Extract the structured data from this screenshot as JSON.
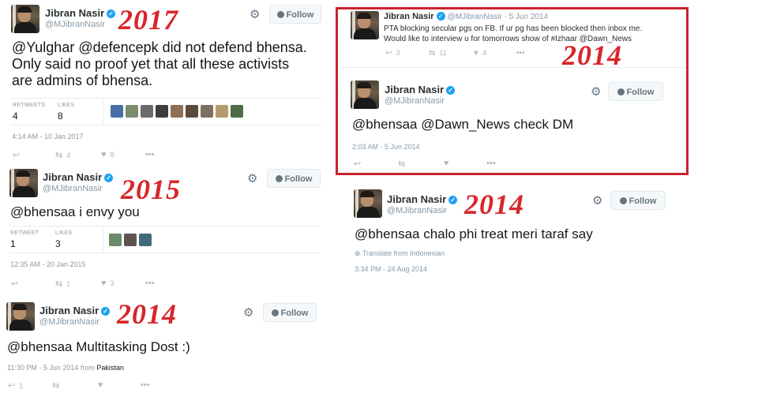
{
  "account": {
    "name": "Jibran Nasir",
    "handle": "@MJibranNasir",
    "follow_label": "Follow"
  },
  "colors": {
    "year_label": "#d8262b",
    "frame": "#c9232b",
    "verified": "#1da1f2"
  },
  "tweet_2017": {
    "year": "2017",
    "lines": [
      "@Yulghar @defencepk did not defend bhensa.",
      "Only said no proof yet that all these activists",
      "are admins of bhensa."
    ],
    "retweets_label": "RETWEETS",
    "retweets": "4",
    "likes_label": "LIKES",
    "likes": "8",
    "time": "4:14 AM - 10 Jan 2017",
    "action_retweets": "4",
    "action_likes": "8",
    "liker_avatar_count": 9
  },
  "tweet_2015": {
    "year": "2015",
    "text": "@bhensaa i envy you",
    "retweets_label": "RETWEET",
    "retweets": "1",
    "likes_label": "LIKES",
    "likes": "3",
    "time": "12:35 AM - 20 Jan 2015",
    "action_retweets": "1",
    "action_likes": "3",
    "liker_avatar_count": 3
  },
  "tweet_2014_multitask": {
    "year": "2014",
    "text": "@bhensaa Multitasking Dost :)",
    "time": "11:30 PM - 5 Jun 2014 from",
    "location": "Pakistan",
    "action_replies": "1"
  },
  "tweet_2014_pta": {
    "header_meta": "@MJibranNasir · 5 Jun 2014",
    "lines": [
      "PTA blocking secular pgs on FB. If ur pg has been blocked then inbox me.",
      "Would like to interview u for tomorrows show of #Izhaar @Dawn_News"
    ],
    "replies": "3",
    "retweets": "11",
    "likes": "4"
  },
  "tweet_2014_dm": {
    "year": "2014",
    "text": "@bhensaa @Dawn_News check DM",
    "time": "2:03 AM - 5 Jun 2014"
  },
  "tweet_2014_treat": {
    "year": "2014",
    "text": "@bhensaa chalo phi treat meri taraf say",
    "translate": "Translate from Indonesian",
    "time": "3:34 PM - 24 Aug 2014"
  }
}
